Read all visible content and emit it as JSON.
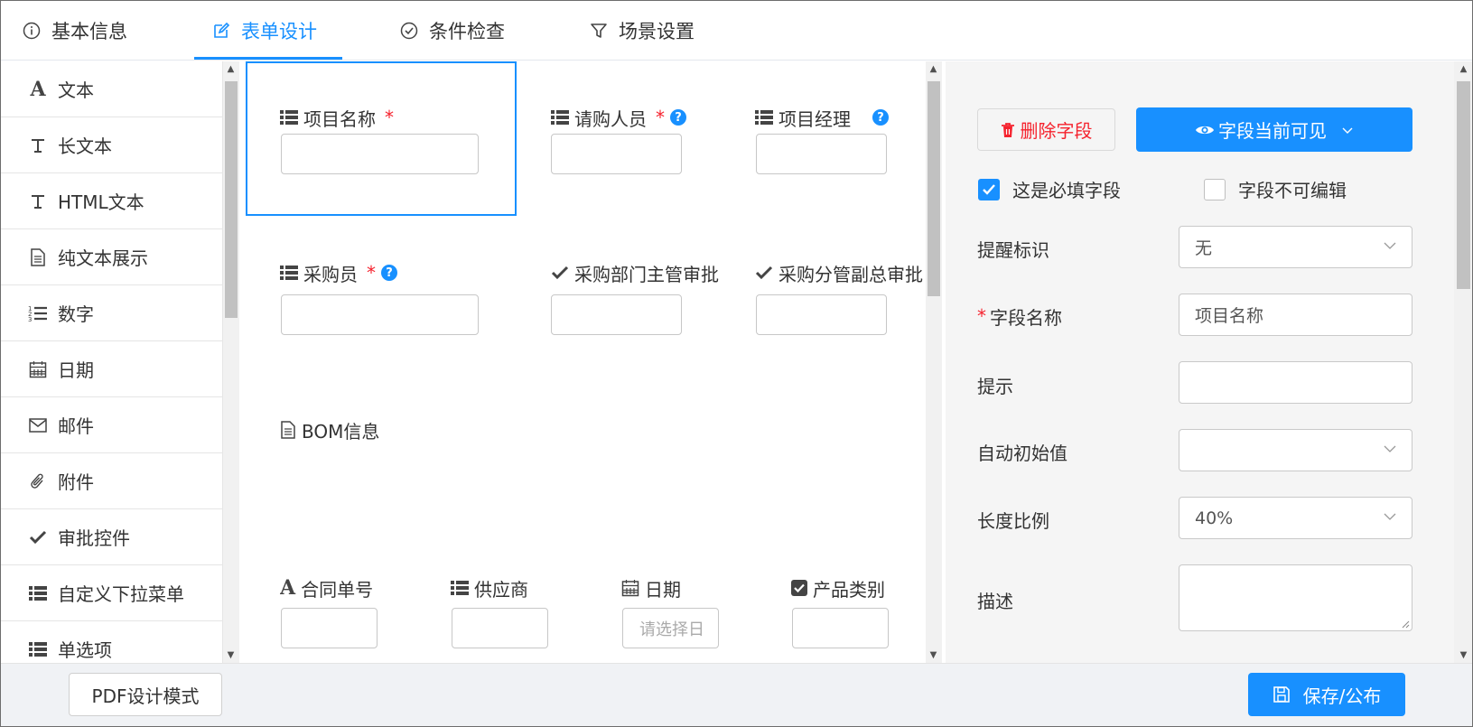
{
  "tabs": [
    {
      "label": "基本信息",
      "icon": "info-circle-icon"
    },
    {
      "label": "表单设计",
      "icon": "edit-icon"
    },
    {
      "label": "条件检查",
      "icon": "check-circle-icon"
    },
    {
      "label": "场景设置",
      "icon": "filter-icon"
    }
  ],
  "active_tab": "表单设计",
  "palette": [
    {
      "label": "文本",
      "icon": "text-a-icon"
    },
    {
      "label": "长文本",
      "icon": "text-t-icon"
    },
    {
      "label": "HTML文本",
      "icon": "text-t-icon"
    },
    {
      "label": "纯文本展示",
      "icon": "document-icon"
    },
    {
      "label": "数字",
      "icon": "numbered-list-icon"
    },
    {
      "label": "日期",
      "icon": "calendar-icon"
    },
    {
      "label": "邮件",
      "icon": "envelope-icon"
    },
    {
      "label": "附件",
      "icon": "paperclip-icon"
    },
    {
      "label": "审批控件",
      "icon": "checkmark-icon"
    },
    {
      "label": "自定义下拉菜单",
      "icon": "list-icon"
    },
    {
      "label": "单选项",
      "icon": "list-icon"
    }
  ],
  "canvas": {
    "fields": {
      "project_name": {
        "label": "项目名称",
        "required": "*"
      },
      "requester": {
        "label": "请购人员",
        "required": "*",
        "help": "?"
      },
      "project_manager": {
        "label": "项目经理",
        "help": "?"
      },
      "purchaser": {
        "label": "采购员",
        "required": "*",
        "help": "?"
      },
      "dept_approval": {
        "label": "采购部门主管审批"
      },
      "vp_approval": {
        "label": "采购分管副总审批"
      },
      "bom": {
        "label": "BOM信息"
      },
      "contract_no": {
        "label": "合同单号"
      },
      "supplier": {
        "label": "供应商"
      },
      "date": {
        "label": "日期",
        "placeholder": "请选择日"
      },
      "product_category": {
        "label": "产品类别"
      }
    }
  },
  "props": {
    "delete_label": "删除字段",
    "visibility_label": "字段当前可见",
    "required_checkbox": {
      "label": "这是必填字段",
      "checked": true
    },
    "readonly_checkbox": {
      "label": "字段不可编辑",
      "checked": false
    },
    "reminder_label": "提醒标识",
    "reminder_value": "无",
    "field_name_label": "字段名称",
    "field_name_star": "*",
    "field_name_value": "项目名称",
    "hint_label": "提示",
    "hint_value": "",
    "auto_init_label": "自动初始值",
    "auto_init_value": "",
    "length_label": "长度比例",
    "length_value": "40%",
    "desc_label": "描述",
    "desc_value": ""
  },
  "footer": {
    "pdf_label": "PDF设计模式",
    "save_label": "保存/公布"
  },
  "colors": {
    "accent": "#1890ff",
    "danger": "#f5222d"
  }
}
